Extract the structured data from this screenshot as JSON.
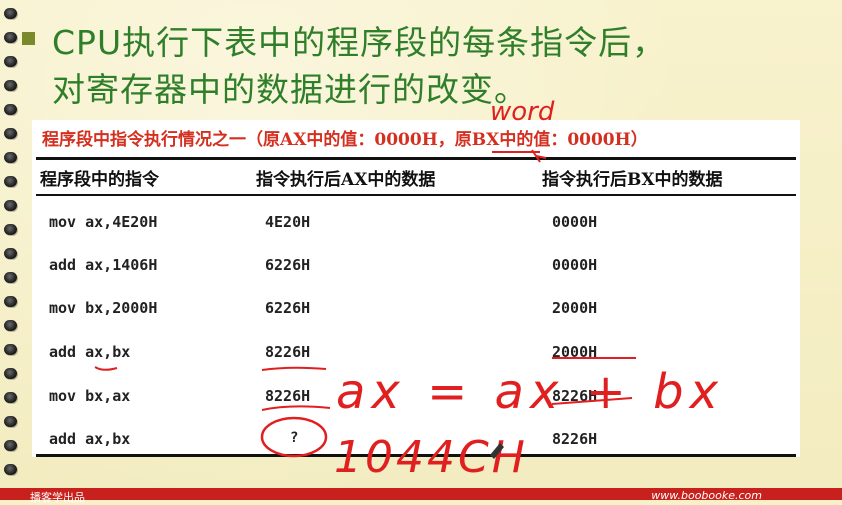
{
  "slide": {
    "title_line1": "CPU执行下表中的程序段的每条指令后，",
    "title_line2": "对寄存器中的数据进行的改变。"
  },
  "table": {
    "caption": "程序段中指令执行情况之一（原AX中的值：0000H，原BX中的值：0000H）",
    "headers": [
      "程序段中的指令",
      "指令执行后AX中的数据",
      "指令执行后BX中的数据"
    ],
    "rows": [
      [
        "mov ax,4E20H",
        "4E20H",
        "0000H"
      ],
      [
        "add ax,1406H",
        "6226H",
        "0000H"
      ],
      [
        "mov bx,2000H",
        "6226H",
        "2000H"
      ],
      [
        "add ax,bx",
        "8226H",
        "2000H"
      ],
      [
        "mov bx,ax",
        "8226H",
        "8226H"
      ],
      [
        "add ax,bx",
        "?",
        "8226H"
      ]
    ]
  },
  "annotations": {
    "word": "word",
    "ax_eq": "ax = ax + bx",
    "result": "1044CH"
  },
  "footer": {
    "left_text": "播客学出品",
    "right_text": "www.boobooke.com"
  },
  "colors": {
    "title_green": "#2f7f2a",
    "caption_red": "#d43020",
    "ink_red": "#e02020",
    "paper": "#f7f1c8"
  }
}
